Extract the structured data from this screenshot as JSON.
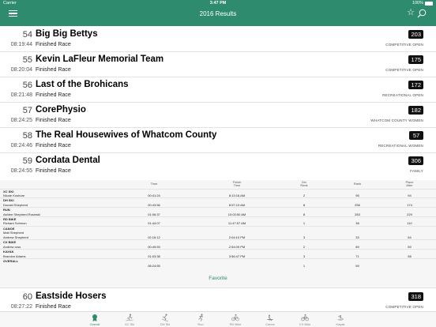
{
  "status_bar": {
    "carrier": "Carrier",
    "time": "3:47 PM",
    "battery": "100%"
  },
  "nav": {
    "title": "2016 Results"
  },
  "results": [
    {
      "place": "54",
      "team": "Big Big Bettys",
      "time": "08:19:44",
      "status": "Finished Race",
      "bib": "203",
      "division": "COMPETITIVE OPEN"
    },
    {
      "place": "55",
      "team": "Kevin LaFleur Memorial Team",
      "time": "08:20:04",
      "status": "Finished Race",
      "bib": "175",
      "division": "COMPETITIVE OPEN"
    },
    {
      "place": "56",
      "team": "Last of the Brohicans",
      "time": "08:21:48",
      "status": "Finished Race",
      "bib": "172",
      "division": "RECREATIONAL OPEN"
    },
    {
      "place": "57",
      "team": "CorePhysio",
      "time": "08:24:25",
      "status": "Finished Race",
      "bib": "182",
      "division": "WHATCOM COUNTY WOMEN"
    },
    {
      "place": "58",
      "team": "The Real Housewives of Whatcom County",
      "time": "08:24:46",
      "status": "Finished Race",
      "bib": "57",
      "division": "RECREATIONAL WOMEN"
    },
    {
      "place": "59",
      "team": "Cordata Dental",
      "time": "08:24:55",
      "status": "Finished Race",
      "bib": "306",
      "division": "FAMILY"
    }
  ],
  "last_result": {
    "place": "60",
    "team": "Eastside Hosers",
    "time": "08:27:22",
    "status": "Finished Race",
    "bib": "318",
    "division": "COMPETITIVE OPEN"
  },
  "splits": {
    "headers": {
      "time": "Time",
      "finish_time": "Finish\nTime",
      "div_rank": "Div\nRank",
      "rank": "Rank",
      "place_after": "Place\nAfter"
    },
    "legs": [
      {
        "leg": "XC SKI",
        "racers": [
          "Nicole Koshure"
        ],
        "time": "00:41:24",
        "finish": "8:13:16 AM",
        "div_rank": "2",
        "rank": "95",
        "place_after": "94"
      },
      {
        "leg": "DH SKI",
        "racers": [
          "Donald Shepherd"
        ],
        "time": "00:43:56",
        "finish": "8:57:13 AM",
        "div_rank": "8",
        "rank": "256",
        "place_after": "174"
      },
      {
        "leg": "RUN",
        "racers": [
          "Ashlee Shepherd Rosinski"
        ],
        "time": "01:06:37",
        "finish": "10:03:50 AM",
        "div_rank": "8",
        "rank": "283",
        "place_after": "229"
      },
      {
        "leg": "RD BIKE",
        "racers": [
          "Richard Schmon"
        ],
        "time": "01:44:07",
        "finish": "11:47:57 AM",
        "div_rank": "1",
        "rank": "38",
        "place_after": "110"
      },
      {
        "leg": "CANOE",
        "racers": [
          "Matt Shepherd",
          "Andrew Shepherd"
        ],
        "time": "02:16:12",
        "finish": "2:04:10 PM",
        "div_rank": "3",
        "rank": "33",
        "place_after": "64"
      },
      {
        "leg": "CX BIKE",
        "racers": [
          "Andrew ross"
        ],
        "time": "00:49:59",
        "finish": "2:54:09 PM",
        "div_rank": "2",
        "rank": "89",
        "place_after": "59"
      },
      {
        "leg": "KAYAK",
        "racers": [
          "Brandon Adams"
        ],
        "time": "01:03:38",
        "finish": "3:56:47 PM",
        "div_rank": "3",
        "rank": "71",
        "place_after": "58"
      },
      {
        "leg": "OVERALL",
        "racers": [],
        "time": "08:24:55",
        "finish": "",
        "div_rank": "1",
        "rank": "59",
        "place_after": ""
      }
    ],
    "favorite_label": "Favorite"
  },
  "tabs": [
    {
      "label": "Overall",
      "icon": "overall-icon",
      "active": true
    },
    {
      "label": "XC Ski",
      "icon": "xc-ski-icon",
      "active": false
    },
    {
      "label": "DH Ski",
      "icon": "dh-ski-icon",
      "active": false
    },
    {
      "label": "Run",
      "icon": "run-icon",
      "active": false
    },
    {
      "label": "RD Bike",
      "icon": "rd-bike-icon",
      "active": false
    },
    {
      "label": "Canoe",
      "icon": "canoe-icon",
      "active": false
    },
    {
      "label": "CX Bike",
      "icon": "cx-bike-icon",
      "active": false
    },
    {
      "label": "Kayak",
      "icon": "kayak-icon",
      "active": false
    }
  ],
  "colors": {
    "accent": "#2e8b6d",
    "bib_bg": "#111111"
  }
}
